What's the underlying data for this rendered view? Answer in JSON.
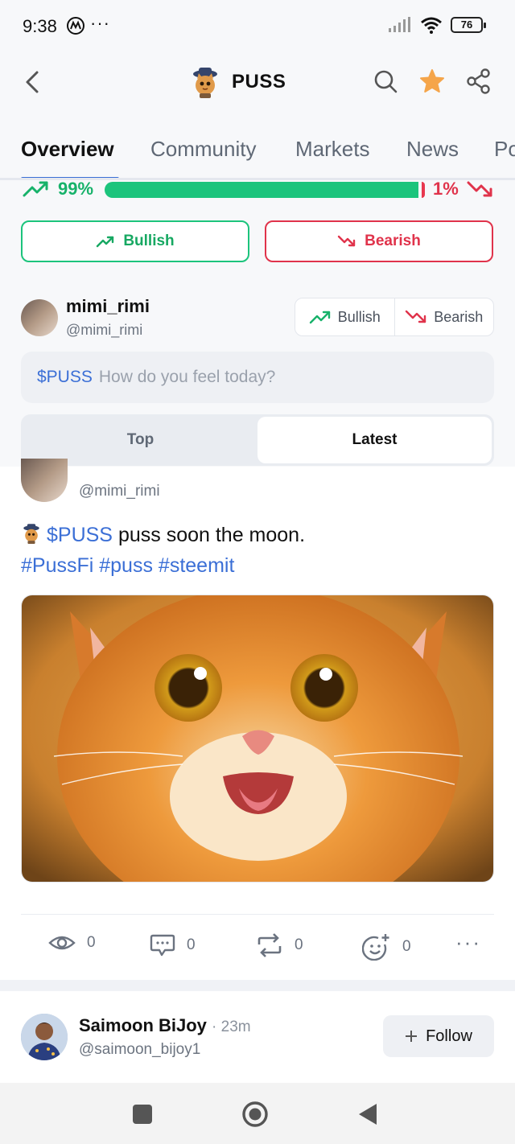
{
  "status_bar": {
    "time": "9:38",
    "icons": [
      "motorola-m-icon",
      "more-dots-icon",
      "signal-icon",
      "wifi-icon"
    ],
    "battery": "76"
  },
  "header": {
    "title": "PUSS",
    "icons": [
      "back-icon",
      "search-icon",
      "star-icon",
      "share-icon"
    ]
  },
  "tabs": [
    "Overview",
    "Community",
    "Markets",
    "News",
    "Po"
  ],
  "sentiment": {
    "bullish_pct": "99%",
    "bearish_pct": "1%",
    "bullish_fraction": 0.99,
    "bull_color": "#1cc47c",
    "bear_color": "#e8384f"
  },
  "vote_buttons": {
    "bullish": "Bullish",
    "bearish": "Bearish"
  },
  "composer": {
    "name": "mimi_rimi",
    "handle": "@mimi_rimi",
    "seg_bullish": "Bullish",
    "seg_bearish": "Bearish",
    "ticker": "$PUSS",
    "placeholder": "How do you feel today?"
  },
  "sort": {
    "top": "Top",
    "latest": "Latest",
    "active": "Latest"
  },
  "post1": {
    "handle": "@mimi_rimi",
    "ticker": "$PUSS",
    "text": "puss soon the moon.",
    "hashtags": "#PussFi #puss #steemit",
    "views": "0",
    "comments": "0",
    "reposts": "0",
    "reactions": "0"
  },
  "post2": {
    "name": "Saimoon BiJoy",
    "time": "· 23m",
    "handle": "@saimoon_bijoy1",
    "follow_label": "Follow"
  },
  "colors": {
    "accent": "#3b6fd6",
    "star": "#f5a54a"
  }
}
